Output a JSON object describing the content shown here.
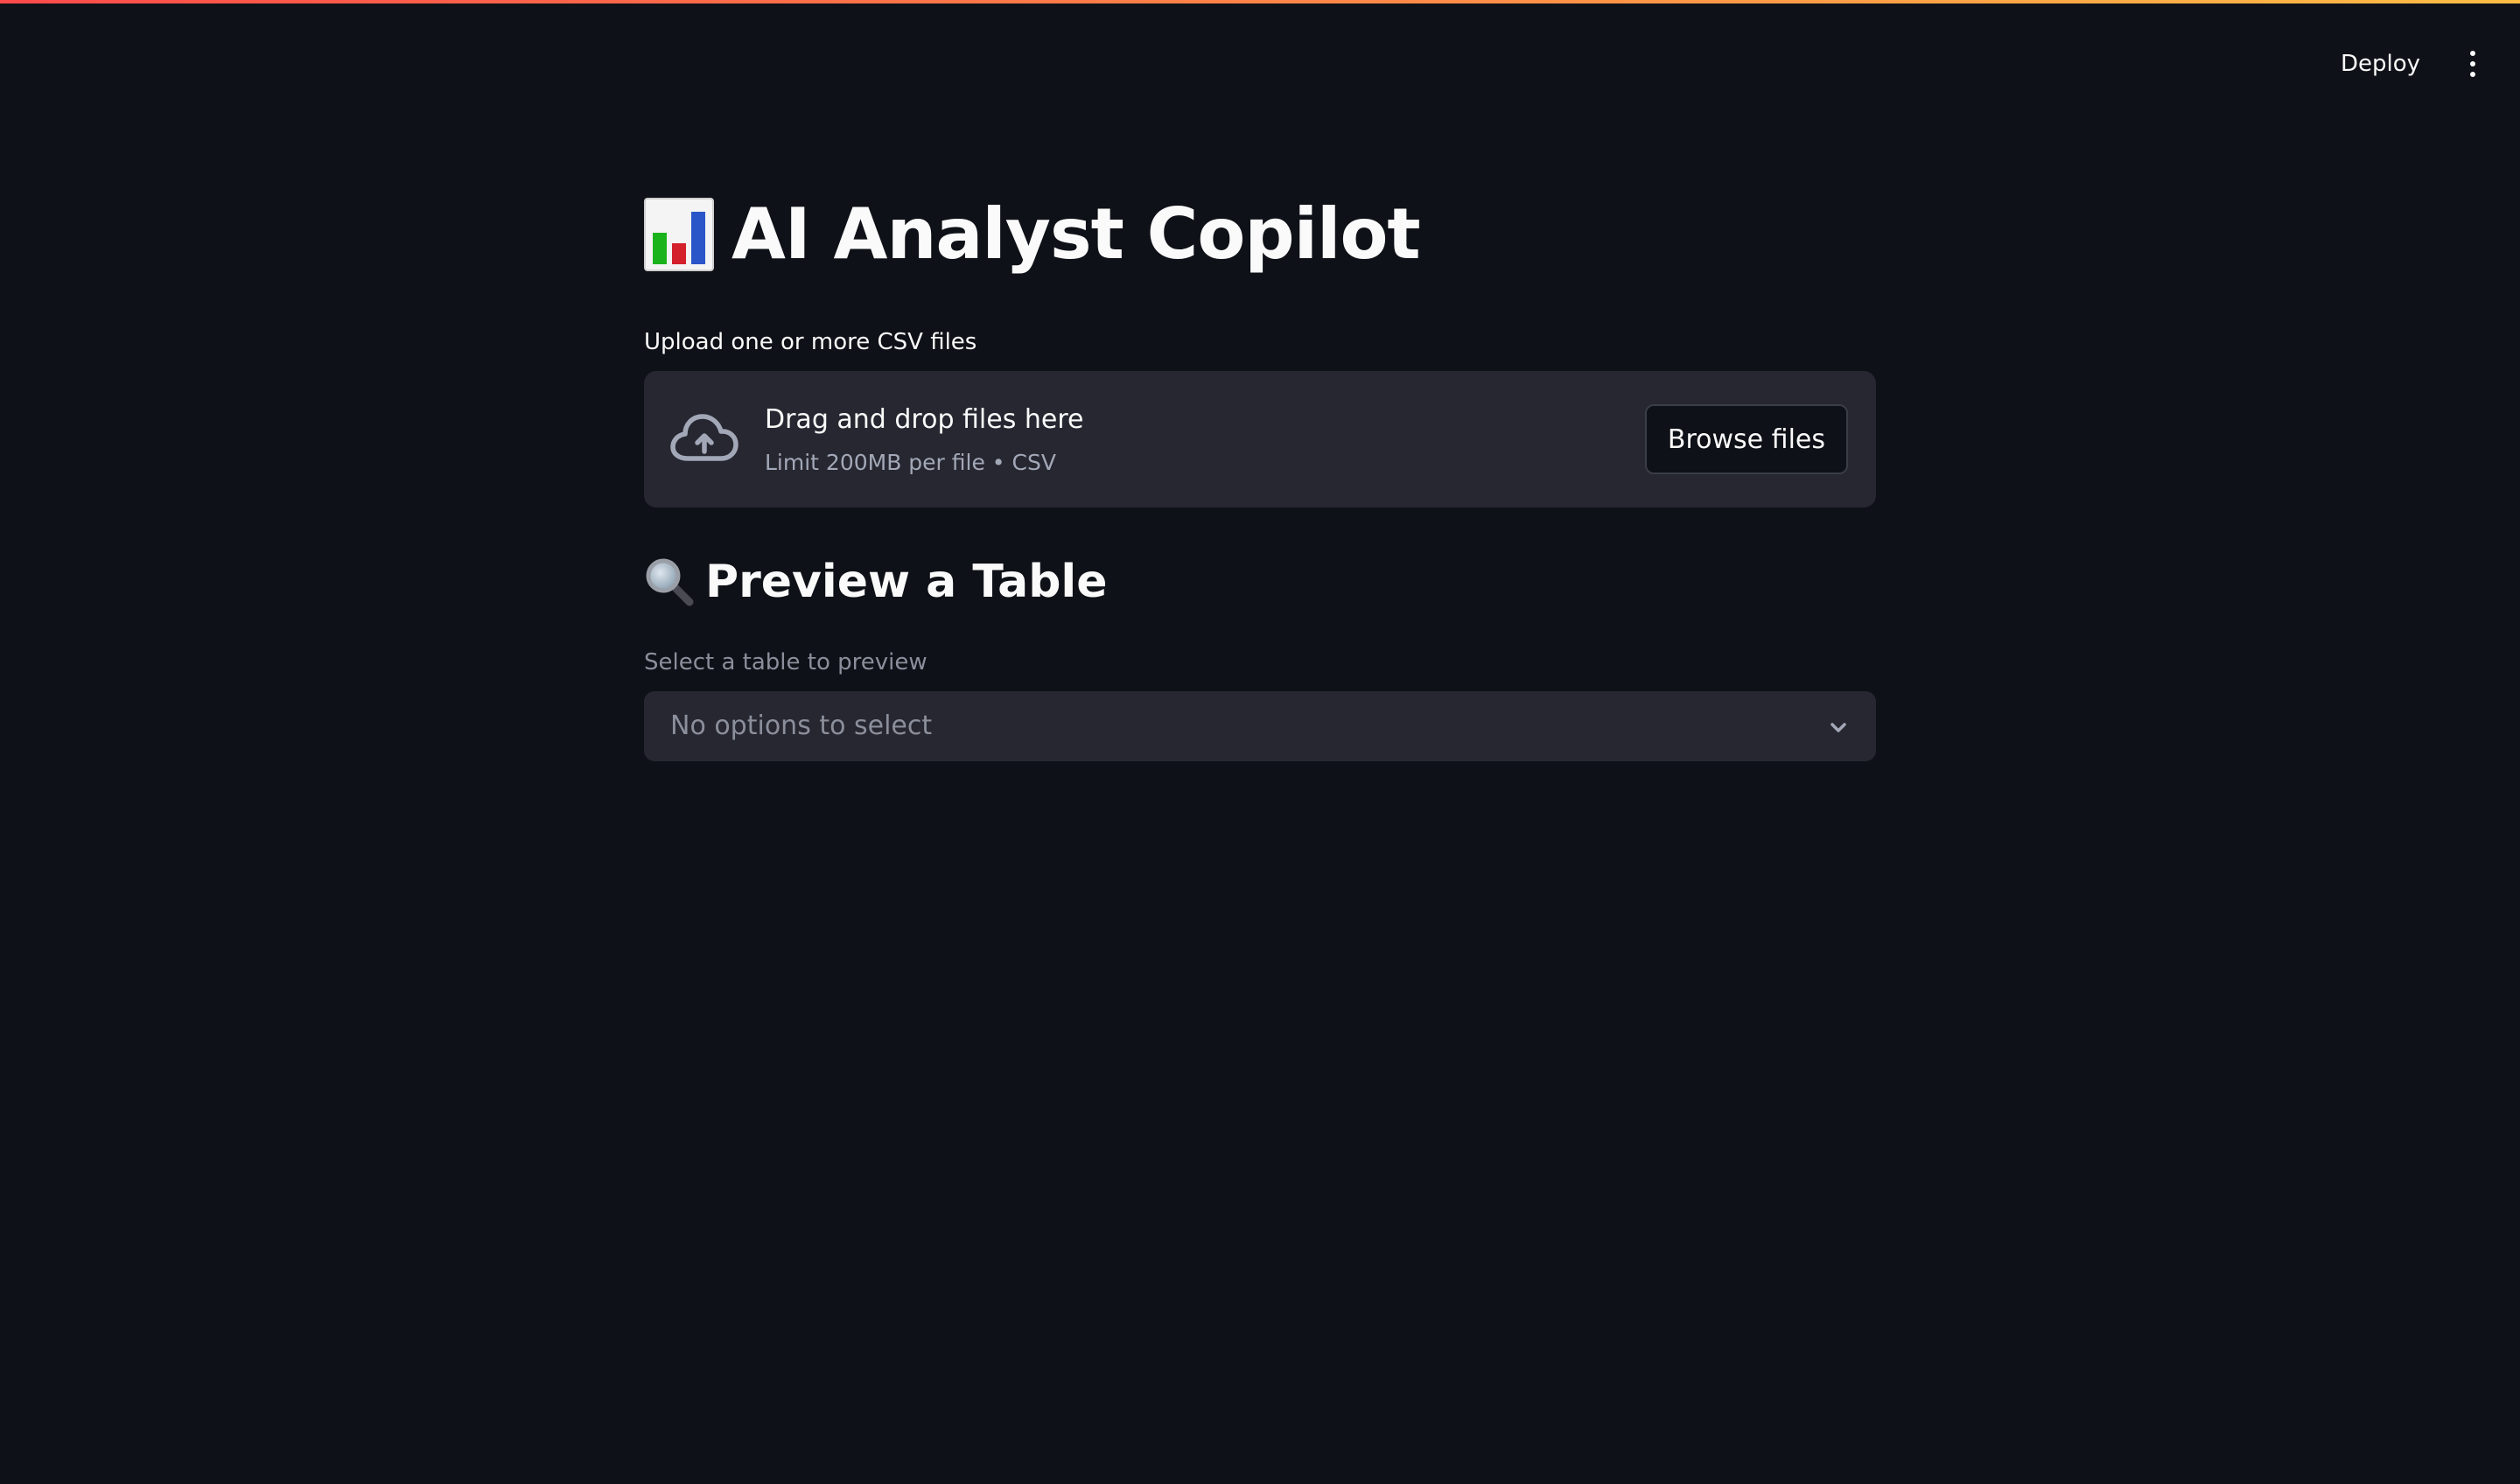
{
  "header": {
    "deploy_label": "Deploy",
    "menu_icon": "more-vertical-icon"
  },
  "colors": {
    "background": "#0e1117",
    "surface": "#262730",
    "text": "#fafafa",
    "muted_text": "#8b8f9c",
    "accent_gradient_start": "#ff4b4b",
    "accent_gradient_end": "#ffbd45"
  },
  "main": {
    "title_icon": "bar-chart-icon",
    "title": "AI Analyst Copilot",
    "uploader": {
      "label": "Upload one or more CSV files",
      "icon": "cloud-upload-icon",
      "drop_text": "Drag and drop files here",
      "limit_text": "Limit 200MB per file • CSV",
      "browse_label": "Browse files"
    },
    "preview": {
      "icon": "magnifying-glass-icon",
      "heading": "Preview a Table",
      "select_label": "Select a table to preview",
      "select_placeholder": "No options to select",
      "chevron_icon": "chevron-down-icon"
    }
  }
}
